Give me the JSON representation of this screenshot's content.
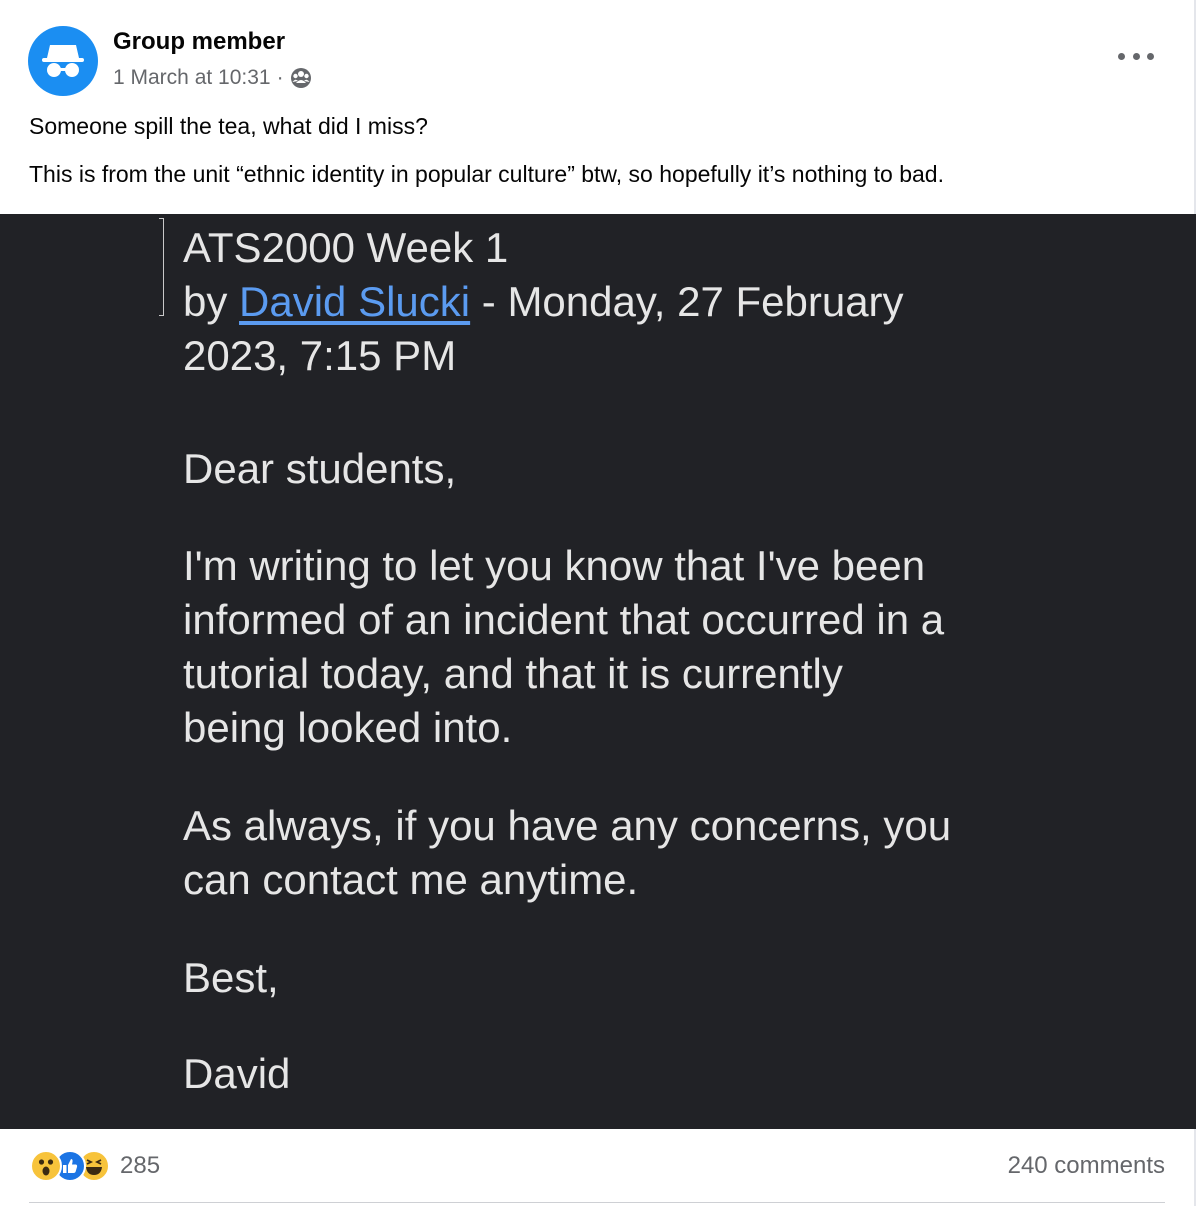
{
  "post": {
    "author": "Group member",
    "timestamp": "1 March at 10:31",
    "separator": "·",
    "audience_icon": "group-icon",
    "more_icon": "more-options-icon",
    "caption_lines": [
      "Someone spill the tea, what did I miss?",
      "This is from the unit “ethnic identity in popular culture” btw, so hopefully it’s nothing to bad."
    ]
  },
  "screenshot": {
    "title": "ATS2000 Week 1",
    "by_prefix": "by ",
    "author_link": "David Slucki",
    "date_line1_suffix": " - Monday, 27 February",
    "date_line2": "2023, 7:15 PM",
    "greeting": "Dear students,",
    "body1": [
      "I'm writing to let you know that I've been",
      "informed of an incident that occurred in a",
      "tutorial today, and that it is currently",
      "being looked into."
    ],
    "body2": [
      "As always, if you have any concerns, you",
      "can contact me anytime."
    ],
    "signoff": "Best,",
    "signature": "David"
  },
  "footer": {
    "reaction_icons": [
      "wow-reaction-icon",
      "like-reaction-icon",
      "haha-reaction-icon"
    ],
    "reaction_count": "285",
    "comments": "240 comments"
  },
  "colors": {
    "avatar": "#1b8ef2",
    "screenshot_bg": "#212226",
    "link": "#5b9bf0",
    "like": "#1b74e4",
    "emoji": "#f7c33b"
  }
}
